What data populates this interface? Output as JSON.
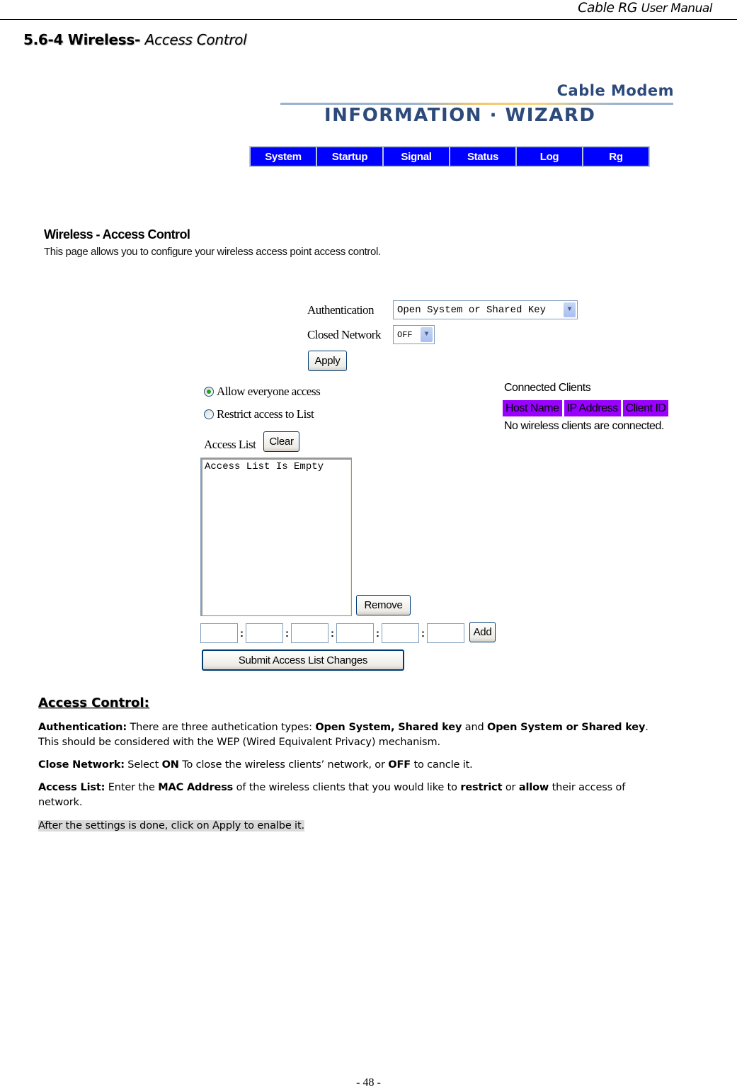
{
  "page_header": {
    "title_main": "Cable RG",
    "title_sub": "User Manual"
  },
  "section": {
    "number_title": "5.6-4 Wireless-",
    "subtitle": "Access Control"
  },
  "logo": {
    "line1": "Cable Modem",
    "line2": "INFORMATION · WIZARD"
  },
  "nav": {
    "items": [
      {
        "label": "System"
      },
      {
        "label": "Startup"
      },
      {
        "label": "Signal"
      },
      {
        "label": "Status"
      },
      {
        "label": "Log"
      },
      {
        "label": "Rg"
      }
    ],
    "color": "#0000ff"
  },
  "screen": {
    "title": "Wireless - Access Control",
    "description": "This page allows you to configure your wireless access point access control.",
    "authentication_label": "Authentication",
    "authentication_value": "Open System or Shared Key",
    "closed_network_label": "Closed Network",
    "closed_network_value": "OFF",
    "apply_label": "Apply",
    "radio_allow_label": "Allow everyone access",
    "radio_allow_checked": true,
    "radio_restrict_label": "Restrict access to List",
    "radio_restrict_checked": false,
    "access_list_label": "Access List",
    "clear_label": "Clear",
    "access_list_content": "Access List Is Empty",
    "remove_label": "Remove",
    "mac_separator": ":",
    "add_label": "Add",
    "submit_label": "Submit Access List Changes",
    "connected_clients": {
      "title": "Connected Clients",
      "headers": [
        "Host Name",
        "IP Address",
        "Client ID"
      ],
      "header_color": "#9900ff",
      "empty_message": "No wireless clients are connected."
    }
  },
  "body": {
    "heading": "Access Control:",
    "auth": {
      "label": "Authentication:",
      "text1": " There are three authetication types: ",
      "bold1": "Open System, Shared key",
      "text2": " and ",
      "bold2": "Open System or Shared key",
      "text3": ".",
      "line2": "This should be considered with the WEP (Wired Equivalent Privacy) mechanism."
    },
    "close_network": {
      "label": "Close Network:",
      "text1": " Select ",
      "bold1": "ON",
      "text2": " To close the wireless clients’ network, or ",
      "bold2": "OFF",
      "text3": " to cancle it."
    },
    "access_list": {
      "label": "Access List:",
      "text1": " Enter the ",
      "bold1": "MAC Address",
      "text2": " of the wireless clients that you would like to ",
      "bold2": "restrict",
      "text3": " or ",
      "bold3": "allow",
      "text4": " their access of",
      "line2": "network."
    },
    "note": "After the settings is done, click on Apply to enalbe it."
  },
  "footer": {
    "page_number": "- 48 -"
  }
}
